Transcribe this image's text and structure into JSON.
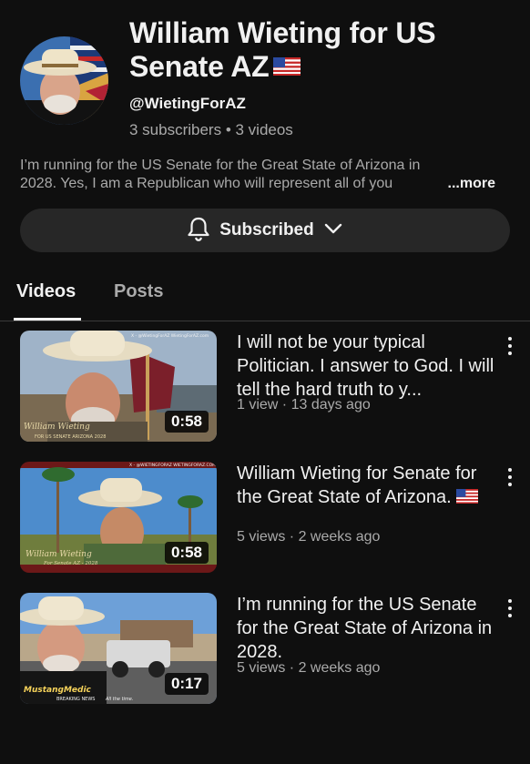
{
  "channel": {
    "title": "William Wieting for US Senate AZ",
    "handle": "@WietingForAZ",
    "stats": "3 subscribers • 3 videos",
    "description_line1": "I’m running for the US Senate for the Great State of Arizona in",
    "description_line2": "2028. Yes, I am a Republican who will represent all of you",
    "more_label": "...more",
    "title_emoji_icon": "us-flag-icon"
  },
  "subscribe": {
    "label": "Subscribed",
    "left_icon": "bell-icon",
    "right_icon": "chevron-down-icon"
  },
  "tabs": [
    {
      "label": "Videos",
      "active": true
    },
    {
      "label": "Posts",
      "active": false
    }
  ],
  "videos": [
    {
      "title": "I will not be your typical Politician. I answer to God. I will tell the hard truth to y...",
      "meta": "1 view · 13 days ago",
      "duration": "0:58",
      "thumb_caption": "William Wieting",
      "thumb_subcaption": "FOR US SENATE ARIZONA 2028",
      "thumb_top_text": "X - @WietingForAZ  WietingForAZ.com"
    },
    {
      "title": "William Wieting for Senate for the Great State of Arizona.",
      "meta": "5 views · 2 weeks ago",
      "duration": "0:58",
      "thumb_caption": "William Wieting",
      "thumb_subcaption": "For Senate AZ - 2028",
      "thumb_top_text": "X - @WIETINGFORAZ  WIETINGFORAZ.COM",
      "title_emoji_icon": "us-flag-icon"
    },
    {
      "title": "I’m running for the US Senate for the Great State of Arizona in 2028.",
      "meta": "5 views · 2 weeks ago",
      "duration": "0:17",
      "thumb_caption": "MustangMedic",
      "thumb_subcaption": "BREAKING NEWS",
      "thumb_tail": "All the time."
    }
  ],
  "colors": {
    "background": "#0f0f0f",
    "button_bg": "#272727",
    "text_primary": "#f1f1f1",
    "text_secondary": "#aaaaaa"
  }
}
